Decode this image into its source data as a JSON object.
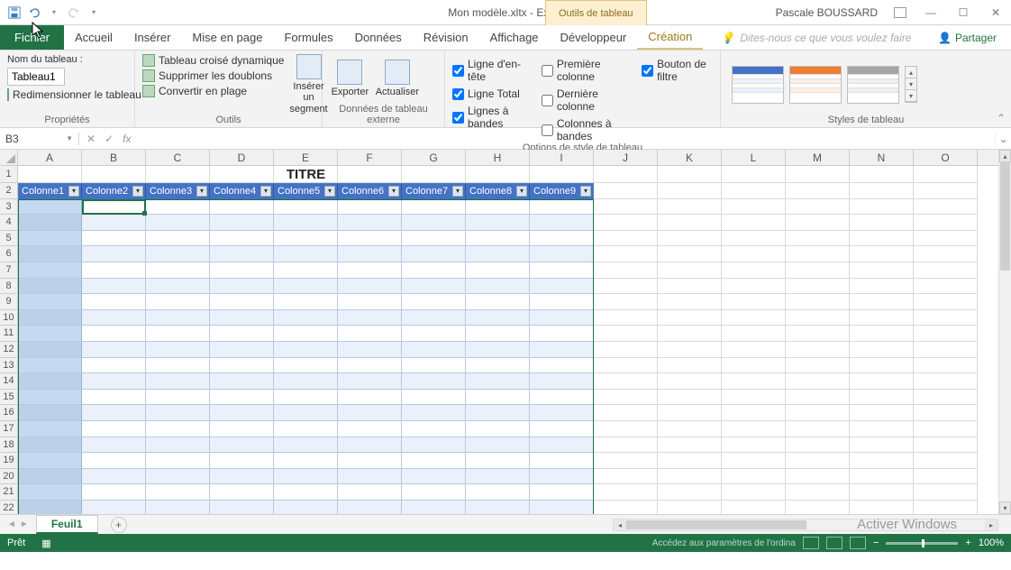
{
  "title": "Mon modèle.xltx - Excel",
  "context_tab": "Outils de tableau",
  "user": "Pascale BOUSSARD",
  "tabs": {
    "file": "Fichier",
    "home": "Accueil",
    "insert": "Insérer",
    "layout": "Mise en page",
    "formulas": "Formules",
    "data": "Données",
    "review": "Révision",
    "view": "Affichage",
    "developer": "Développeur",
    "creation": "Création"
  },
  "tell_me": "Dites-nous ce que vous voulez faire",
  "share": "Partager",
  "ribbon": {
    "properties": {
      "label": "Propriétés",
      "name_label": "Nom du tableau :",
      "name_value": "Tableau1",
      "resize": "Redimensionner le tableau"
    },
    "tools": {
      "label": "Outils",
      "pivot": "Tableau croisé dynamique",
      "remove_dup": "Supprimer les doublons",
      "convert": "Convertir en plage",
      "slicer": "Insérer un segment"
    },
    "external": {
      "label": "Données de tableau externe",
      "export": "Exporter",
      "refresh": "Actualiser"
    },
    "style_opts": {
      "label": "Options de style de tableau",
      "header_row": "Ligne d'en-tête",
      "total_row": "Ligne Total",
      "banded_rows": "Lignes à bandes",
      "first_col": "Première colonne",
      "last_col": "Dernière colonne",
      "banded_cols": "Colonnes à bandes",
      "filter_btn": "Bouton de filtre"
    },
    "styles": {
      "label": "Styles de tableau"
    }
  },
  "name_box": "B3",
  "fx_label": "fx",
  "columns": [
    "A",
    "B",
    "C",
    "D",
    "E",
    "F",
    "G",
    "H",
    "I",
    "J",
    "K",
    "L",
    "M",
    "N",
    "O"
  ],
  "rows": [
    1,
    2,
    3,
    4,
    5,
    6,
    7,
    8,
    9,
    10,
    11,
    12,
    13,
    14,
    15,
    16,
    17,
    18,
    19,
    20,
    21,
    22
  ],
  "sheet_title": "TITRE",
  "table_headers": [
    "Colonne1",
    "Colonne2",
    "Colonne3",
    "Colonne4",
    "Colonne5",
    "Colonne6",
    "Colonne7",
    "Colonne8",
    "Colonne9"
  ],
  "sheet_name": "Feuil1",
  "status": "Prêt",
  "watermark": "Activer Windows",
  "status_hint": "Accédez aux paramètres de l'ordina",
  "zoom": "100%"
}
